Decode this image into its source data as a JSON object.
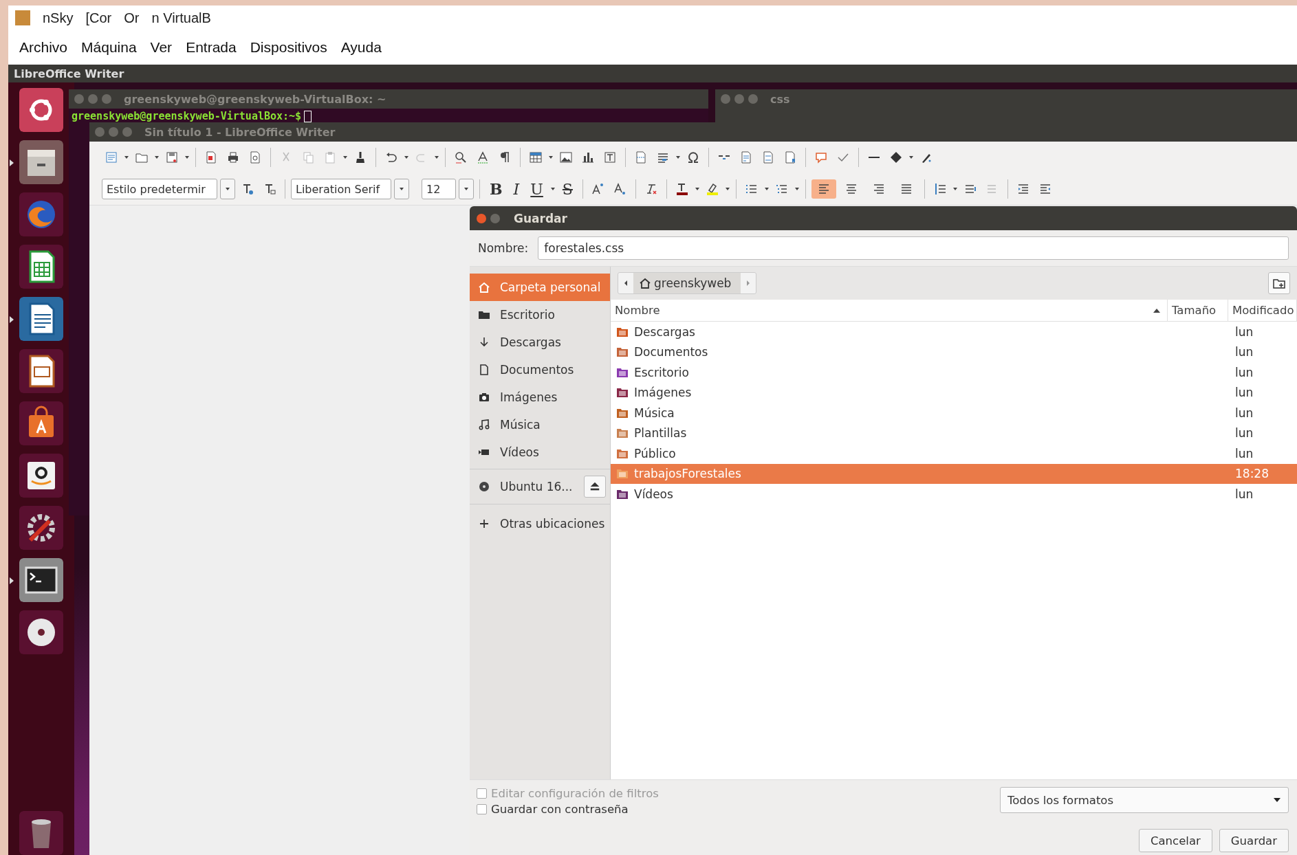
{
  "vm_window": {
    "title_fragments": [
      "nSky",
      "[Cor",
      "Or",
      "n VirtualB"
    ],
    "menu": [
      "Archivo",
      "Máquina",
      "Ver",
      "Entrada",
      "Dispositivos",
      "Ayuda"
    ]
  },
  "top_panel": {
    "title": "LibreOffice Writer"
  },
  "launcher": {
    "items": [
      {
        "kind": "ubuntu",
        "running": false,
        "selected": false
      },
      {
        "kind": "files",
        "running": true,
        "selected": false
      },
      {
        "kind": "browser",
        "running": false,
        "selected": false
      },
      {
        "kind": "calc",
        "running": false,
        "selected": false
      },
      {
        "kind": "writer",
        "running": true,
        "selected": true
      },
      {
        "kind": "impress",
        "running": false,
        "selected": false
      },
      {
        "kind": "store",
        "running": false,
        "selected": false
      },
      {
        "kind": "amazon",
        "running": false,
        "selected": false
      },
      {
        "kind": "settings",
        "running": false,
        "selected": false
      },
      {
        "kind": "terminal",
        "running": true,
        "selected": false
      },
      {
        "kind": "disc",
        "running": false,
        "selected": false
      },
      {
        "kind": "trash",
        "running": false,
        "selected": false
      }
    ]
  },
  "terminal": {
    "title": "greenskyweb@greenskyweb-VirtualBox: ~",
    "prompt": "greenskyweb@greenskyweb-VirtualBox:~$"
  },
  "css_window": {
    "title": "css"
  },
  "writer": {
    "title": "Sin título 1 - LibreOffice Writer",
    "paragraph_style": "Estilo predetermir",
    "font_name": "Liberation Serif",
    "font_size": "12",
    "format_buttons": [
      {
        "kind": "bold",
        "label": "B"
      },
      {
        "kind": "italic",
        "label": "I"
      },
      {
        "kind": "underline",
        "label": "U"
      },
      {
        "kind": "strike",
        "label": "S"
      }
    ],
    "align_buttons": [
      {
        "selected": true
      },
      {
        "selected": false
      },
      {
        "selected": false
      },
      {
        "selected": false
      }
    ]
  },
  "dialog": {
    "title": "Guardar",
    "name_label": "Nombre:",
    "name_value": "forestales.css",
    "places": [
      {
        "kind": "home",
        "label": "Carpeta personal",
        "selected": true
      },
      {
        "kind": "desktop",
        "label": "Escritorio",
        "selected": false
      },
      {
        "kind": "downloads",
        "label": "Descargas",
        "selected": false
      },
      {
        "kind": "documents",
        "label": "Documentos",
        "selected": false
      },
      {
        "kind": "pictures",
        "label": "Imágenes",
        "selected": false
      },
      {
        "kind": "music",
        "label": "Música",
        "selected": false
      },
      {
        "kind": "videos",
        "label": "Vídeos",
        "selected": false
      },
      {
        "kind": "drive",
        "label": "Ubuntu 16...",
        "selected": false
      },
      {
        "kind": "other",
        "label": "Otras ubicaciones",
        "selected": false
      }
    ],
    "path": "greenskyweb",
    "columns": [
      "Nombre",
      "Tamaño",
      "Modificado"
    ],
    "files": [
      {
        "kind": "downloads",
        "name": "Descargas",
        "modified": "lun",
        "selected": false
      },
      {
        "kind": "documents",
        "name": "Documentos",
        "modified": "lun",
        "selected": false
      },
      {
        "kind": "desktop",
        "name": "Escritorio",
        "modified": "lun",
        "selected": false
      },
      {
        "kind": "pictures",
        "name": "Imágenes",
        "modified": "lun",
        "selected": false
      },
      {
        "kind": "music",
        "name": "Música",
        "modified": "lun",
        "selected": false
      },
      {
        "kind": "templates",
        "name": "Plantillas",
        "modified": "lun",
        "selected": false
      },
      {
        "kind": "public",
        "name": "Público",
        "modified": "lun",
        "selected": false
      },
      {
        "kind": "folder",
        "name": "trabajosForestales",
        "modified": "18:28",
        "selected": true
      },
      {
        "kind": "videos",
        "name": "Vídeos",
        "modified": "lun",
        "selected": false
      }
    ],
    "options": [
      {
        "label": "Editar configuración de filtros",
        "checked": false,
        "disabled": true
      },
      {
        "label": "Guardar con contraseña",
        "checked": false,
        "disabled": false
      }
    ],
    "filter": "Todos los formatos",
    "buttons": [
      "Cancelar",
      "Guardar"
    ]
  }
}
